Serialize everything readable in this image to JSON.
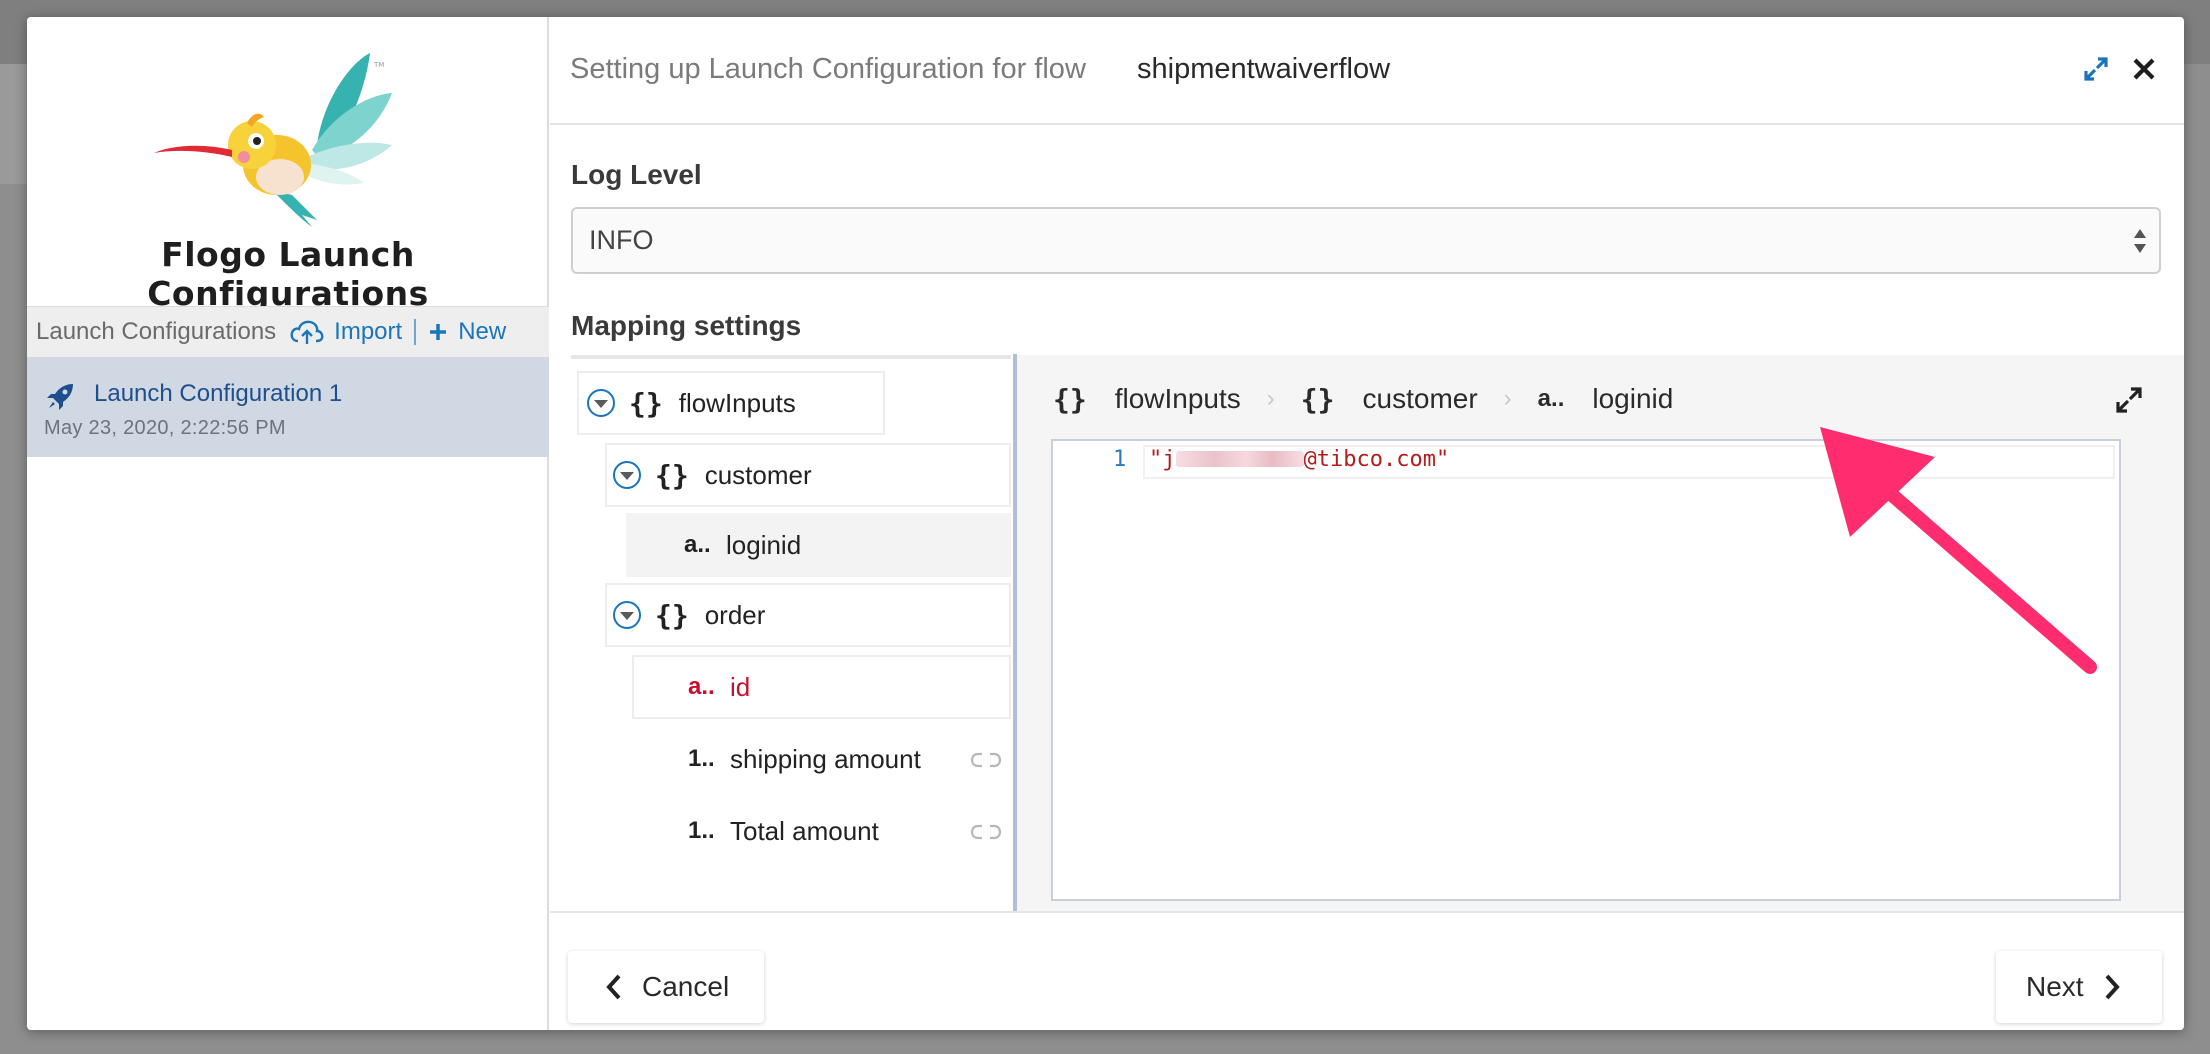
{
  "sidebar": {
    "brand_title": "Flogo Launch Configurations",
    "toolbar": {
      "title": "Launch Configurations",
      "import_label": "Import",
      "new_label": "New"
    },
    "configs": [
      {
        "name": "Launch Configuration 1",
        "date": "May 23, 2020, 2:22:56 PM"
      }
    ]
  },
  "header": {
    "prefix": "Setting up Launch Configuration for flow",
    "flow_name": "shipmentwaiverflow"
  },
  "log_level": {
    "label": "Log Level",
    "value": "INFO"
  },
  "mapping": {
    "label": "Mapping settings",
    "tree": [
      {
        "label": "flowInputs",
        "icon": "{}",
        "type": "object"
      },
      {
        "label": "customer",
        "icon": "{}",
        "type": "object"
      },
      {
        "label": "loginid",
        "icon": "a..",
        "type": "string",
        "selected": true
      },
      {
        "label": "order",
        "icon": "{}",
        "type": "object"
      },
      {
        "label": "id",
        "icon": "a..",
        "type": "string",
        "required": true
      },
      {
        "label": "shipping amount",
        "icon": "1..",
        "type": "number"
      },
      {
        "label": "Total amount",
        "icon": "1..",
        "type": "number"
      }
    ],
    "breadcrumb": [
      {
        "icon": "{}",
        "label": "flowInputs"
      },
      {
        "icon": "{}",
        "label": "customer"
      },
      {
        "icon": "a..",
        "label": "loginid"
      }
    ],
    "editor": {
      "line_number": "1",
      "code_prefix": "\"j",
      "code_suffix": "@tibco.com\""
    }
  },
  "footer": {
    "cancel_label": "Cancel",
    "next_label": "Next"
  },
  "colors": {
    "accent": "#1b75bb",
    "selected_row": "#cfd8e3",
    "required_field": "#c8102e",
    "annotation_arrow": "#ff2d6f"
  }
}
